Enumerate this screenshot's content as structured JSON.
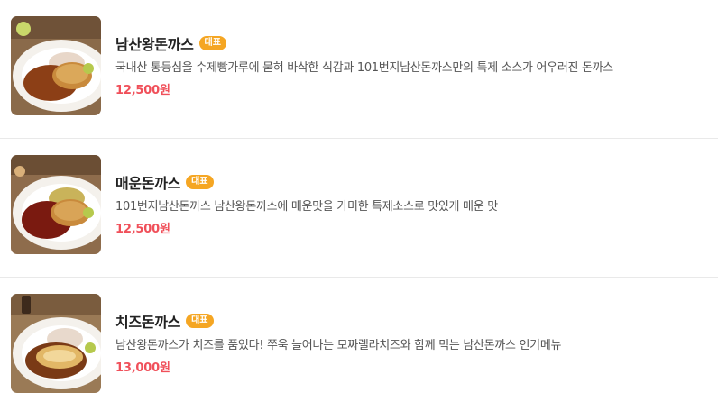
{
  "menu": {
    "items": [
      {
        "name": "남산왕돈까스",
        "badge": "대표",
        "description": "국내산 통등심을 수제빵가루에 묻혀 바삭한 식감과 101번지남산돈까스만의 특제 소스가 어우러진 돈까스",
        "price": "12,500원",
        "image_icon": "pork-cutlet-plate-image"
      },
      {
        "name": "매운돈까스",
        "badge": "대표",
        "description": "101번지남산돈까스 남산왕돈까스에 매운맛을 가미한 특제소스로 맛있게 매운 맛",
        "price": "12,500원",
        "image_icon": "spicy-cutlet-plate-image"
      },
      {
        "name": "치즈돈까스",
        "badge": "대표",
        "description": "남산왕돈까스가 치즈를 품었다! 쭈욱 늘어나는 모짜렐라치즈와 함께 먹는 남산돈까스 인기메뉴",
        "price": "13,000원",
        "image_icon": "cheese-cutlet-plate-image"
      }
    ]
  },
  "colors": {
    "badge_bg": "#f5a623",
    "price": "#f0505a",
    "divider": "#e9e9e9"
  }
}
